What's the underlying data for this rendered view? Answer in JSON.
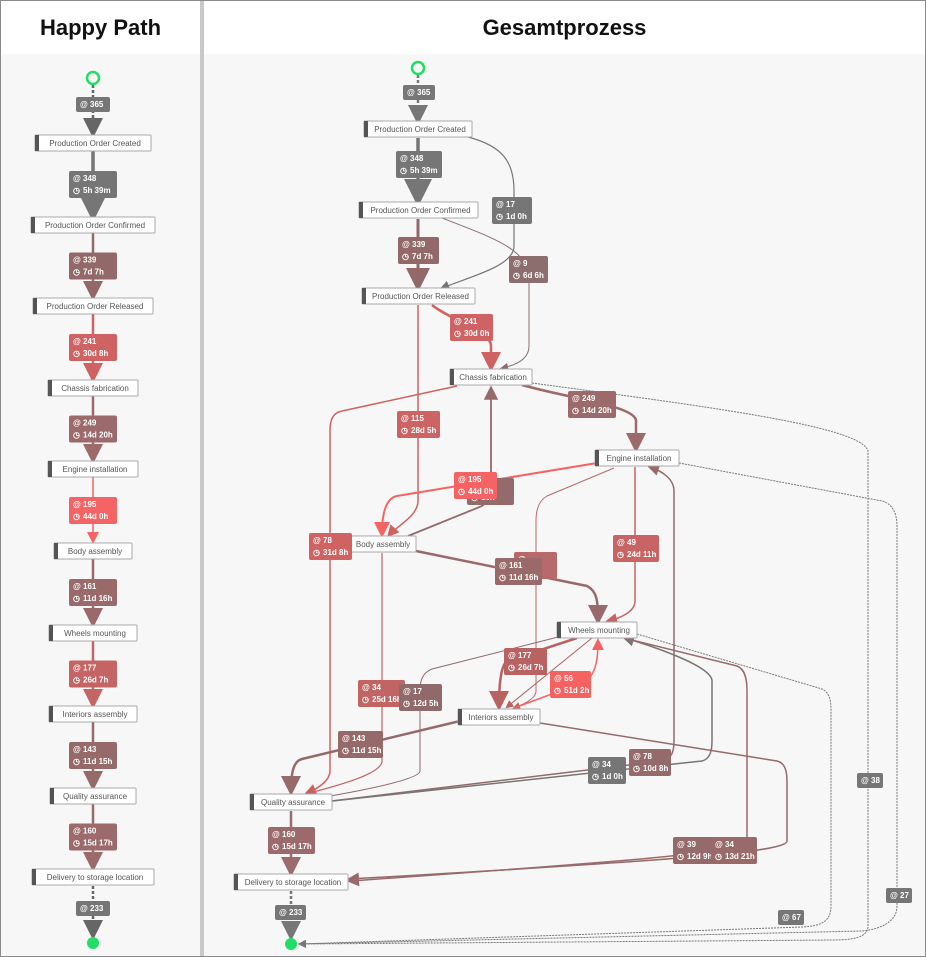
{
  "happy_path": {
    "title": "Happy Path",
    "start_count": "365",
    "end_count": "233",
    "activities": [
      "Production Order Created",
      "Production Order Confirmed",
      "Production Order Released",
      "Chassis fabrication",
      "Engine installation",
      "Body assembly",
      "Wheels mounting",
      "Interiors assembly",
      "Quality assurance",
      "Delivery to storage location"
    ],
    "transitions": [
      {
        "count": "348",
        "duration": "5h 39m",
        "color": "#767676"
      },
      {
        "count": "339",
        "duration": "7d 7h",
        "color": "#926868"
      },
      {
        "count": "241",
        "duration": "30d 8h",
        "color": "#cf6262"
      },
      {
        "count": "249",
        "duration": "14d 20h",
        "color": "#9c6a6a"
      },
      {
        "count": "195",
        "duration": "44d 0h",
        "color": "#f46464"
      },
      {
        "count": "161",
        "duration": "11d 16h",
        "color": "#9a6a6a"
      },
      {
        "count": "177",
        "duration": "26d 7h",
        "color": "#c46464"
      },
      {
        "count": "143",
        "duration": "11d 15h",
        "color": "#976a6a"
      },
      {
        "count": "160",
        "duration": "15d 17h",
        "color": "#9c6a6a"
      }
    ]
  },
  "gesamtprozess": {
    "title": "Gesamtprozess",
    "start_count": "365",
    "activities": [
      "Production Order Created",
      "Production Order Confirmed",
      "Production Order Released",
      "Chassis fabrication",
      "Engine installation",
      "Body assembly",
      "Wheels mounting",
      "Interiors assembly",
      "Quality assurance",
      "Delivery to storage location"
    ],
    "edges": [
      {
        "count": "348",
        "duration": "5h 39m",
        "color": "#767676"
      },
      {
        "count": "17",
        "duration": "1d 0h",
        "color": "#767676"
      },
      {
        "count": "339",
        "duration": "7d 7h",
        "color": "#926868"
      },
      {
        "count": "9",
        "duration": "6d 6h",
        "color": "#8c6e6e"
      },
      {
        "count": "241",
        "duration": "30d 0h",
        "color": "#cf6262"
      },
      {
        "count": "249",
        "duration": "14d 20h",
        "color": "#9c6a6a"
      },
      {
        "count": "115",
        "duration": "28d 5h",
        "color": "#cc6464"
      },
      {
        "count": "",
        "duration": "16h",
        "color": "#946a6a"
      },
      {
        "count": "195",
        "duration": "44d 0h",
        "color": "#f46464"
      },
      {
        "count": "78",
        "duration": "31d 8h",
        "color": "#cf6262"
      },
      {
        "count": "49",
        "duration": "24d 11h",
        "color": "#c86464"
      },
      {
        "count": "",
        "duration": "8h",
        "color": "#b86a6a"
      },
      {
        "count": "161",
        "duration": "11d 16h",
        "color": "#9a6a6a"
      },
      {
        "count": "177",
        "duration": "26d 7h",
        "color": "#b86262"
      },
      {
        "count": "56",
        "duration": "51d 2h",
        "color": "#f56262"
      },
      {
        "count": "34",
        "duration": "25d 16h",
        "color": "#c06464"
      },
      {
        "count": "17",
        "duration": "12d 5h",
        "color": "#906a6a"
      },
      {
        "count": "143",
        "duration": "11d 15h",
        "color": "#976a6a"
      },
      {
        "count": "34",
        "duration": "1d 0h",
        "color": "#767676"
      },
      {
        "count": "78",
        "duration": "10d 8h",
        "color": "#946a6a"
      },
      {
        "count": "160",
        "duration": "15d 17h",
        "color": "#9c6a6a"
      },
      {
        "count": "39",
        "duration": "12d 9h",
        "color": "#946a6a"
      },
      {
        "count": "34",
        "duration": "13d 21h",
        "color": "#9a6a6a"
      }
    ],
    "end_edges": [
      {
        "count": "233",
        "color": "#767676"
      },
      {
        "count": "38",
        "color": "#767676"
      },
      {
        "count": "27",
        "color": "#767676"
      },
      {
        "count": "67",
        "color": "#767676"
      }
    ]
  },
  "colors": {
    "start": "#22dd66",
    "end": "#22dd66",
    "node_bar": "#555555"
  },
  "icons": {
    "count": "frequency-icon",
    "duration": "clock-icon"
  }
}
